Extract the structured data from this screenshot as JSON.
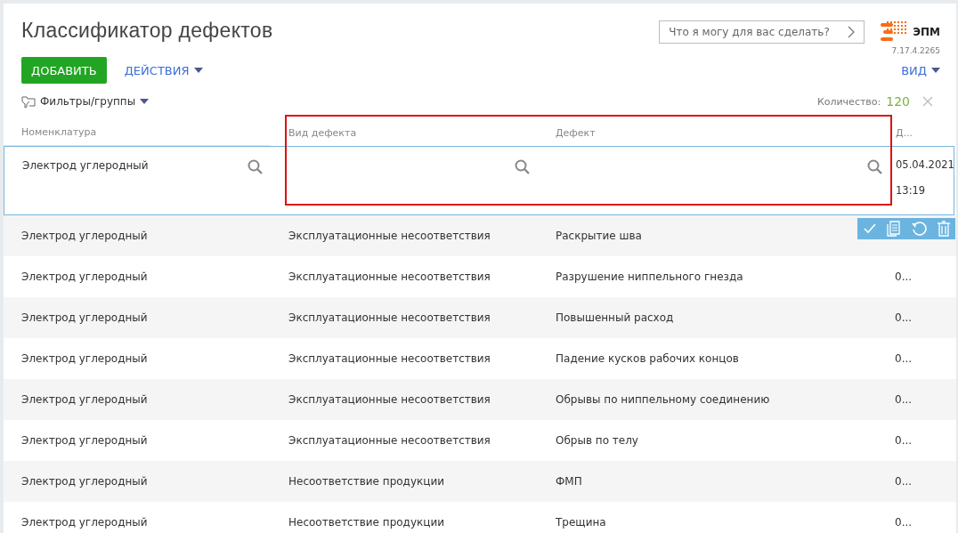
{
  "page": {
    "title": "Классификатор дефектов",
    "assistant_placeholder": "Что я могу для вас сделать?",
    "logo_text": "ЭПМ",
    "version": "7.17.4.2265"
  },
  "toolbar": {
    "add_button": "ДОБАВИТЬ",
    "actions_menu": "ДЕЙСТВИЯ",
    "view_menu": "ВИД",
    "filters": "Фильтры/группы",
    "count_label": "Количество:",
    "count": "120"
  },
  "table": {
    "columns": [
      "Номенклатура",
      "Вид дефекта",
      "Дефект",
      "Д..."
    ],
    "edit_row": {
      "nomenclature": "Электрод углеродный",
      "date": "05.04.2021",
      "time": "13:19",
      "highlight_frame": true
    },
    "rows": [
      {
        "cells": [
          "Электрод углеродный",
          "Эксплуатационные несоответствия",
          "Раскрытие шва",
          ""
        ]
      },
      {
        "cells": [
          "Электрод углеродный",
          "Эксплуатационные несоответствия",
          "Разрушение ниппельного гнезда",
          "0..."
        ]
      },
      {
        "cells": [
          "Электрод углеродный",
          "Эксплуатационные несоответствия",
          "Повышенный расход",
          "0..."
        ]
      },
      {
        "cells": [
          "Электрод углеродный",
          "Эксплуатационные несоответствия",
          "Падение кусков рабочих концов",
          "0..."
        ]
      },
      {
        "cells": [
          "Электрод углеродный",
          "Эксплуатационные несоответствия",
          "Обрывы по ниппельному соединению",
          "0..."
        ]
      },
      {
        "cells": [
          "Электрод углеродный",
          "Эксплуатационные несоответствия",
          "Обрыв по телу",
          "0..."
        ]
      },
      {
        "cells": [
          "Электрод углеродный",
          "Несоответствие продукции",
          "ФМП",
          "0..."
        ]
      },
      {
        "cells": [
          "Электрод углеродный",
          "Несоответствие продукции",
          "Трещина",
          "0..."
        ]
      }
    ]
  }
}
